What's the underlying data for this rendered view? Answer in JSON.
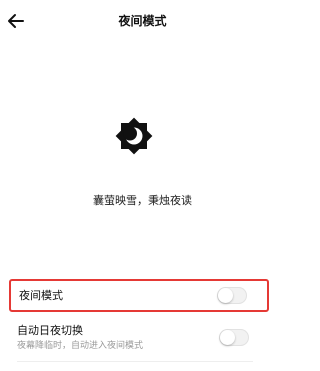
{
  "header": {
    "title": "夜间模式",
    "back_icon": "arrow-left-icon"
  },
  "hero": {
    "icon": "moon-sun-icon",
    "slogan": "囊萤映雪，秉烛夜读"
  },
  "settings": {
    "night_mode": {
      "label": "夜间模式",
      "enabled": false
    },
    "auto_switch": {
      "label": "自动日夜切换",
      "description": "夜幕降临时，自动进入夜间模式",
      "enabled": false
    }
  },
  "colors": {
    "highlight_border": "#e53935",
    "toggle_off": "#f2f2f2",
    "text_primary": "#111111",
    "text_secondary": "#9a9a9a"
  }
}
